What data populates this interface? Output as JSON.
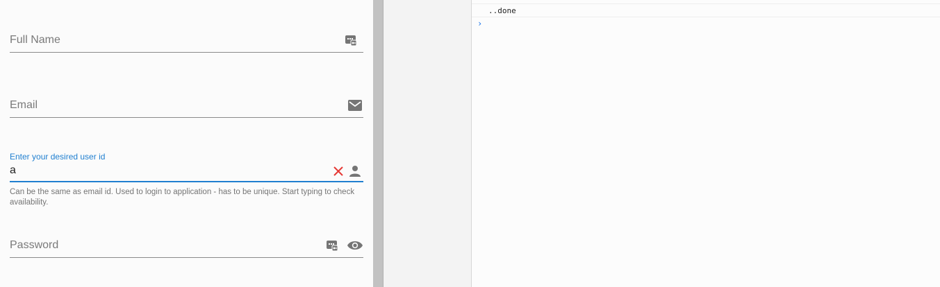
{
  "form": {
    "full_name": {
      "placeholder": "Full Name",
      "icon": "id-card-icon"
    },
    "email": {
      "placeholder": "Email",
      "icon": "mail-icon"
    },
    "user_id": {
      "label": "Enter your desired user id",
      "value": "a",
      "hint": "Can be the same as email id. Used to login to application - has to be unique. Start typing to check availability.",
      "status_icon": "close-icon",
      "icon": "person-icon",
      "accent_color": "#1f7fd0",
      "error_color": "#e53935"
    },
    "password": {
      "placeholder": "Password",
      "icons": [
        "id-card-icon",
        "eye-icon"
      ]
    }
  },
  "console": {
    "lines": [
      "..done"
    ],
    "prompt": "›"
  }
}
